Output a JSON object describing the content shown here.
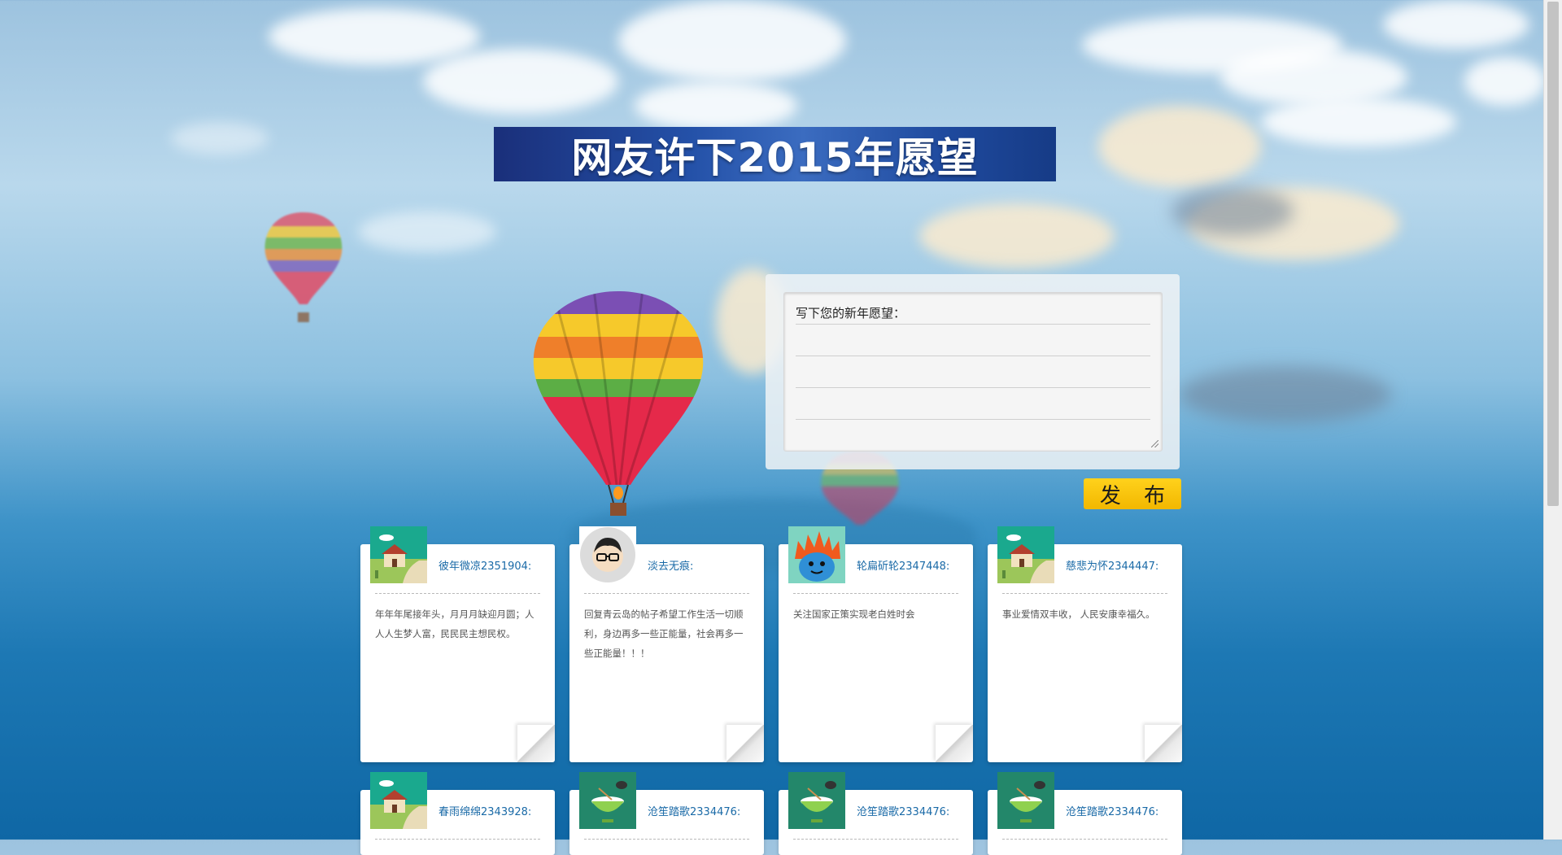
{
  "title": "网友许下2015年愿望",
  "wish_form": {
    "label": "写下您的新年愿望：",
    "publish_label": "发 布"
  },
  "cards": [
    {
      "name": "彼年微凉2351904:",
      "content": "年年年尾接年头，月月月缺迎月圆；人人人生梦人富，民民民主想民权。",
      "avatar": "house-avatar-icon"
    },
    {
      "name": "淡去无痕:",
      "content": "回复青云岛的帖子希望工作生活一切顺利，身边再多一些正能量，社会再多一些正能量！！！",
      "avatar": "glasses-face-avatar-icon"
    },
    {
      "name": "轮扁斫轮2347448:",
      "content": "关注国家正策实现老白姓时会",
      "avatar": "flame-monster-avatar-icon"
    },
    {
      "name": "慈悲为怀2344447:",
      "content": "事业爱情双丰收， 人民安康幸福久。",
      "avatar": "house-avatar-icon"
    },
    {
      "name": "春雨绵绵2343928:",
      "content": "",
      "avatar": "house-avatar-icon"
    },
    {
      "name": "沧笙踏歌2334476:",
      "content": "",
      "avatar": "rice-bowl-avatar-icon"
    },
    {
      "name": "沧笙踏歌2334476:",
      "content": "",
      "avatar": "rice-bowl-avatar-icon"
    },
    {
      "name": "沧笙踏歌2334476:",
      "content": "",
      "avatar": "rice-bowl-avatar-icon"
    }
  ],
  "colors": {
    "accent_yellow": "#ffc600",
    "name_blue": "#1a6aa7",
    "banner_blue": "#2451a8"
  }
}
